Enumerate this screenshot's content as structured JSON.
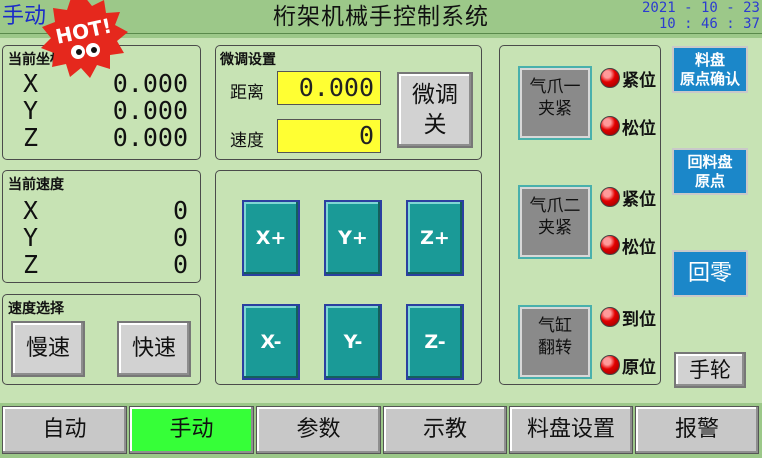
{
  "header": {
    "title": "桁架机械手控制系统",
    "mode": "手动",
    "date": "2021 - 10 - 23",
    "time": "10 : 46 : 37"
  },
  "badge": {
    "text": "HOT!"
  },
  "position": {
    "title": "当前坐标",
    "x_label": "X",
    "x": "0.000",
    "y_label": "Y",
    "y": "0.000",
    "z_label": "Z",
    "z": "0.000"
  },
  "speed": {
    "title": "当前速度",
    "x_label": "X",
    "x": "0",
    "y_label": "Y",
    "y": "0",
    "z_label": "Z",
    "z": "0"
  },
  "speed_select": {
    "title": "速度选择",
    "slow": "慢速",
    "fast": "快速"
  },
  "fine": {
    "title": "微调设置",
    "distance_label": "距离",
    "distance": "0.000",
    "speed_label": "速度",
    "speed": "0",
    "toggle_line1": "微调",
    "toggle_line2": "关"
  },
  "jog": {
    "xp": "X+",
    "yp": "Y+",
    "zp": "Z+",
    "xm": "X-",
    "ym": "Y-",
    "zm": "Z-"
  },
  "io": {
    "g1_line1": "气爪一",
    "g1_line2": "夹紧",
    "g1_l1": "紧位",
    "g1_l2": "松位",
    "g2_line1": "气爪二",
    "g2_line2": "夹紧",
    "g2_l1": "紧位",
    "g2_l2": "松位",
    "cy_line1": "气缸",
    "cy_line2": "翻转",
    "cy_l1": "到位",
    "cy_l2": "原位"
  },
  "right": {
    "confirm_line1": "料盘",
    "confirm_line2": "原点确认",
    "return_line1": "回料盘",
    "return_line2": "原点",
    "zero": "回零",
    "handwheel": "手轮"
  },
  "tabs": [
    "自动",
    "手动",
    "参数",
    "示教",
    "料盘设置",
    "报警"
  ],
  "colors": {
    "background": "#9cc889",
    "panel": "#c7e3b4",
    "yellow": "#ffff33",
    "teal": "#1a9a97",
    "blue": "#1b87c9",
    "active_tab": "#36ff38",
    "led": "#e20000"
  }
}
